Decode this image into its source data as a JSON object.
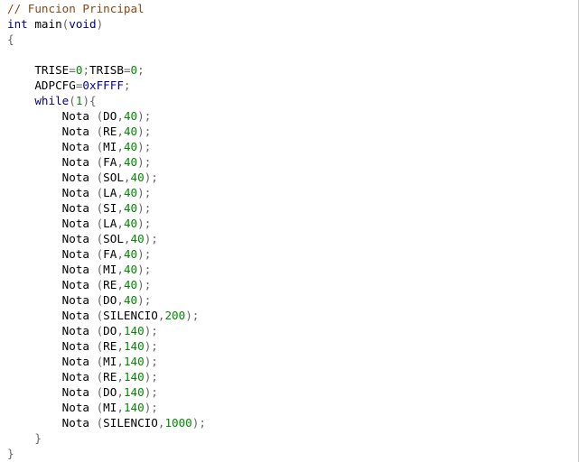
{
  "code": {
    "language": "C",
    "lines": [
      [
        {
          "t": "// Funcion Principal",
          "k": "cmt"
        }
      ],
      [
        {
          "t": "int",
          "k": "kw"
        },
        {
          "t": " main",
          "k": "txt"
        },
        {
          "t": "(",
          "k": "pun"
        },
        {
          "t": "void",
          "k": "kw"
        },
        {
          "t": ")",
          "k": "pun"
        }
      ],
      [
        {
          "t": "{",
          "k": "pun"
        }
      ],
      [],
      [
        {
          "t": "    TRISE",
          "k": "txt"
        },
        {
          "t": "=",
          "k": "pun"
        },
        {
          "t": "0",
          "k": "num"
        },
        {
          "t": ";",
          "k": "pun"
        },
        {
          "t": "TRISB",
          "k": "txt"
        },
        {
          "t": "=",
          "k": "pun"
        },
        {
          "t": "0",
          "k": "num"
        },
        {
          "t": ";",
          "k": "pun"
        }
      ],
      [
        {
          "t": "    ADPCFG",
          "k": "txt"
        },
        {
          "t": "=",
          "k": "pun"
        },
        {
          "t": "0xFFFF",
          "k": "hex"
        },
        {
          "t": ";",
          "k": "pun"
        }
      ],
      [
        {
          "t": "    while",
          "k": "kw"
        },
        {
          "t": "(",
          "k": "pun"
        },
        {
          "t": "1",
          "k": "num"
        },
        {
          "t": "){",
          "k": "pun"
        }
      ],
      [
        {
          "t": "        Nota ",
          "k": "txt"
        },
        {
          "t": "(",
          "k": "pun"
        },
        {
          "t": "DO",
          "k": "txt"
        },
        {
          "t": ",",
          "k": "pun"
        },
        {
          "t": "40",
          "k": "num"
        },
        {
          "t": ");",
          "k": "pun"
        }
      ],
      [
        {
          "t": "        Nota ",
          "k": "txt"
        },
        {
          "t": "(",
          "k": "pun"
        },
        {
          "t": "RE",
          "k": "txt"
        },
        {
          "t": ",",
          "k": "pun"
        },
        {
          "t": "40",
          "k": "num"
        },
        {
          "t": ");",
          "k": "pun"
        }
      ],
      [
        {
          "t": "        Nota ",
          "k": "txt"
        },
        {
          "t": "(",
          "k": "pun"
        },
        {
          "t": "MI",
          "k": "txt"
        },
        {
          "t": ",",
          "k": "pun"
        },
        {
          "t": "40",
          "k": "num"
        },
        {
          "t": ");",
          "k": "pun"
        }
      ],
      [
        {
          "t": "        Nota ",
          "k": "txt"
        },
        {
          "t": "(",
          "k": "pun"
        },
        {
          "t": "FA",
          "k": "txt"
        },
        {
          "t": ",",
          "k": "pun"
        },
        {
          "t": "40",
          "k": "num"
        },
        {
          "t": ");",
          "k": "pun"
        }
      ],
      [
        {
          "t": "        Nota ",
          "k": "txt"
        },
        {
          "t": "(",
          "k": "pun"
        },
        {
          "t": "SOL",
          "k": "txt"
        },
        {
          "t": ",",
          "k": "pun"
        },
        {
          "t": "40",
          "k": "num"
        },
        {
          "t": ");",
          "k": "pun"
        }
      ],
      [
        {
          "t": "        Nota ",
          "k": "txt"
        },
        {
          "t": "(",
          "k": "pun"
        },
        {
          "t": "LA",
          "k": "txt"
        },
        {
          "t": ",",
          "k": "pun"
        },
        {
          "t": "40",
          "k": "num"
        },
        {
          "t": ");",
          "k": "pun"
        }
      ],
      [
        {
          "t": "        Nota ",
          "k": "txt"
        },
        {
          "t": "(",
          "k": "pun"
        },
        {
          "t": "SI",
          "k": "txt"
        },
        {
          "t": ",",
          "k": "pun"
        },
        {
          "t": "40",
          "k": "num"
        },
        {
          "t": ");",
          "k": "pun"
        }
      ],
      [
        {
          "t": "        Nota ",
          "k": "txt"
        },
        {
          "t": "(",
          "k": "pun"
        },
        {
          "t": "LA",
          "k": "txt"
        },
        {
          "t": ",",
          "k": "pun"
        },
        {
          "t": "40",
          "k": "num"
        },
        {
          "t": ");",
          "k": "pun"
        }
      ],
      [
        {
          "t": "        Nota ",
          "k": "txt"
        },
        {
          "t": "(",
          "k": "pun"
        },
        {
          "t": "SOL",
          "k": "txt"
        },
        {
          "t": ",",
          "k": "pun"
        },
        {
          "t": "40",
          "k": "num"
        },
        {
          "t": ");",
          "k": "pun"
        }
      ],
      [
        {
          "t": "        Nota ",
          "k": "txt"
        },
        {
          "t": "(",
          "k": "pun"
        },
        {
          "t": "FA",
          "k": "txt"
        },
        {
          "t": ",",
          "k": "pun"
        },
        {
          "t": "40",
          "k": "num"
        },
        {
          "t": ");",
          "k": "pun"
        }
      ],
      [
        {
          "t": "        Nota ",
          "k": "txt"
        },
        {
          "t": "(",
          "k": "pun"
        },
        {
          "t": "MI",
          "k": "txt"
        },
        {
          "t": ",",
          "k": "pun"
        },
        {
          "t": "40",
          "k": "num"
        },
        {
          "t": ");",
          "k": "pun"
        }
      ],
      [
        {
          "t": "        Nota ",
          "k": "txt"
        },
        {
          "t": "(",
          "k": "pun"
        },
        {
          "t": "RE",
          "k": "txt"
        },
        {
          "t": ",",
          "k": "pun"
        },
        {
          "t": "40",
          "k": "num"
        },
        {
          "t": ");",
          "k": "pun"
        }
      ],
      [
        {
          "t": "        Nota ",
          "k": "txt"
        },
        {
          "t": "(",
          "k": "pun"
        },
        {
          "t": "DO",
          "k": "txt"
        },
        {
          "t": ",",
          "k": "pun"
        },
        {
          "t": "40",
          "k": "num"
        },
        {
          "t": ");",
          "k": "pun"
        }
      ],
      [
        {
          "t": "        Nota ",
          "k": "txt"
        },
        {
          "t": "(",
          "k": "pun"
        },
        {
          "t": "SILENCIO",
          "k": "txt"
        },
        {
          "t": ",",
          "k": "pun"
        },
        {
          "t": "200",
          "k": "num"
        },
        {
          "t": ");",
          "k": "pun"
        }
      ],
      [
        {
          "t": "        Nota ",
          "k": "txt"
        },
        {
          "t": "(",
          "k": "pun"
        },
        {
          "t": "DO",
          "k": "txt"
        },
        {
          "t": ",",
          "k": "pun"
        },
        {
          "t": "140",
          "k": "num"
        },
        {
          "t": ");",
          "k": "pun"
        }
      ],
      [
        {
          "t": "        Nota ",
          "k": "txt"
        },
        {
          "t": "(",
          "k": "pun"
        },
        {
          "t": "RE",
          "k": "txt"
        },
        {
          "t": ",",
          "k": "pun"
        },
        {
          "t": "140",
          "k": "num"
        },
        {
          "t": ");",
          "k": "pun"
        }
      ],
      [
        {
          "t": "        Nota ",
          "k": "txt"
        },
        {
          "t": "(",
          "k": "pun"
        },
        {
          "t": "MI",
          "k": "txt"
        },
        {
          "t": ",",
          "k": "pun"
        },
        {
          "t": "140",
          "k": "num"
        },
        {
          "t": ");",
          "k": "pun"
        }
      ],
      [
        {
          "t": "        Nota ",
          "k": "txt"
        },
        {
          "t": "(",
          "k": "pun"
        },
        {
          "t": "RE",
          "k": "txt"
        },
        {
          "t": ",",
          "k": "pun"
        },
        {
          "t": "140",
          "k": "num"
        },
        {
          "t": ");",
          "k": "pun"
        }
      ],
      [
        {
          "t": "        Nota ",
          "k": "txt"
        },
        {
          "t": "(",
          "k": "pun"
        },
        {
          "t": "DO",
          "k": "txt"
        },
        {
          "t": ",",
          "k": "pun"
        },
        {
          "t": "140",
          "k": "num"
        },
        {
          "t": ");",
          "k": "pun"
        }
      ],
      [
        {
          "t": "        Nota ",
          "k": "txt"
        },
        {
          "t": "(",
          "k": "pun"
        },
        {
          "t": "MI",
          "k": "txt"
        },
        {
          "t": ",",
          "k": "pun"
        },
        {
          "t": "140",
          "k": "num"
        },
        {
          "t": ");",
          "k": "pun"
        }
      ],
      [
        {
          "t": "        Nota ",
          "k": "txt"
        },
        {
          "t": "(",
          "k": "pun"
        },
        {
          "t": "SILENCIO",
          "k": "txt"
        },
        {
          "t": ",",
          "k": "pun"
        },
        {
          "t": "1000",
          "k": "num"
        },
        {
          "t": ");",
          "k": "pun"
        }
      ],
      [
        {
          "t": "    }",
          "k": "pun"
        }
      ],
      [
        {
          "t": "}",
          "k": "pun"
        }
      ]
    ]
  },
  "colors": {
    "comment": "#8b4513",
    "keyword": "#00008b",
    "number": "#008800",
    "hex": "#0000aa",
    "punctuation": "#666666",
    "text": "#000000",
    "background": "#ffffff"
  }
}
